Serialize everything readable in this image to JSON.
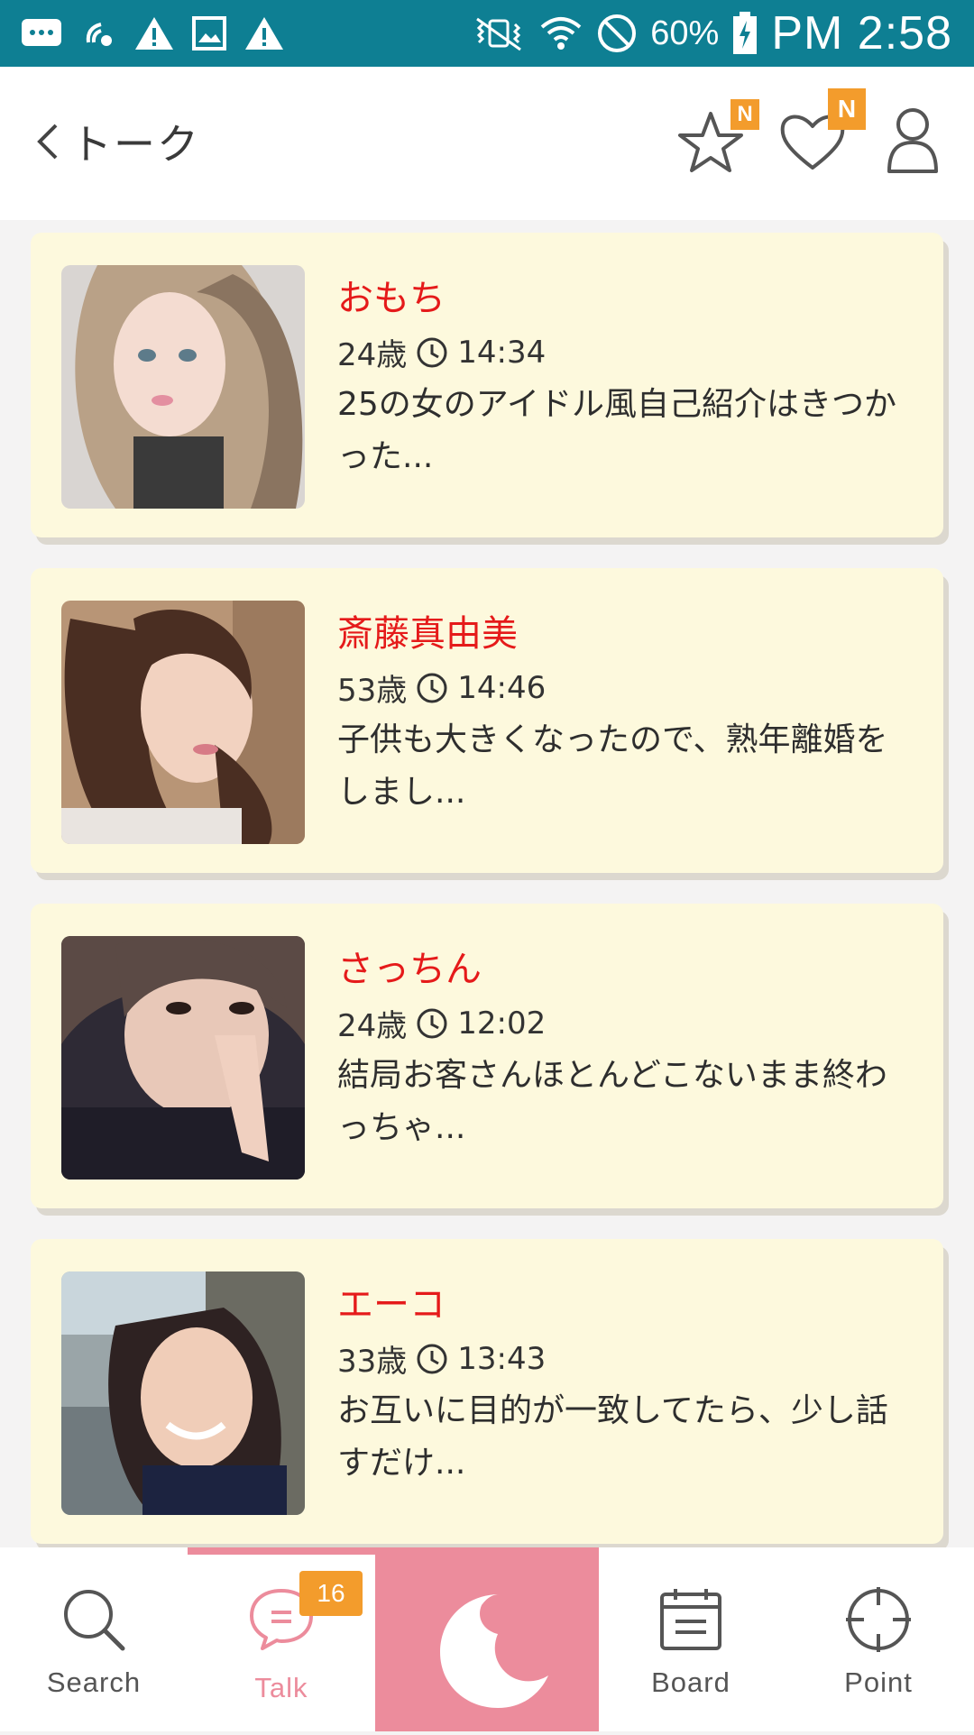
{
  "status_bar": {
    "battery_percent": "60%",
    "time": "PM 2:58",
    "icons": [
      "chat-bubble-icon",
      "wifi-calling-icon",
      "warning-icon",
      "image-icon",
      "warning-icon",
      "vibrate-icon",
      "wifi-icon",
      "do-not-disturb-icon",
      "battery-charging-icon"
    ]
  },
  "header": {
    "title": "トーク",
    "favorites_badge": "N",
    "likes_badge": "N"
  },
  "talks": [
    {
      "name": "おもち",
      "age": "24歳",
      "time": "14:34",
      "message": "25の女のアイドル風自己紹介はきつかった..."
    },
    {
      "name": "斎藤真由美",
      "age": "53歳",
      "time": "14:46",
      "message": "子供も大きくなったので、熟年離婚をしまし..."
    },
    {
      "name": "さっちん",
      "age": "24歳",
      "time": "12:02",
      "message": "結局お客さんほとんどこないまま終わっちゃ..."
    },
    {
      "name": "エーコ",
      "age": "33歳",
      "time": "13:43",
      "message": "お互いに目的が一致してたら、少し話すだけ..."
    }
  ],
  "bottom_nav": {
    "search": "Search",
    "talk": "Talk",
    "talk_badge": "16",
    "board": "Board",
    "point": "Point"
  },
  "colors": {
    "status_bar": "#0e7f93",
    "card_bg": "#fdf9dd",
    "name_red": "#e51a1a",
    "accent_pink": "#ec8c9c",
    "badge_orange": "#f39c2c"
  }
}
